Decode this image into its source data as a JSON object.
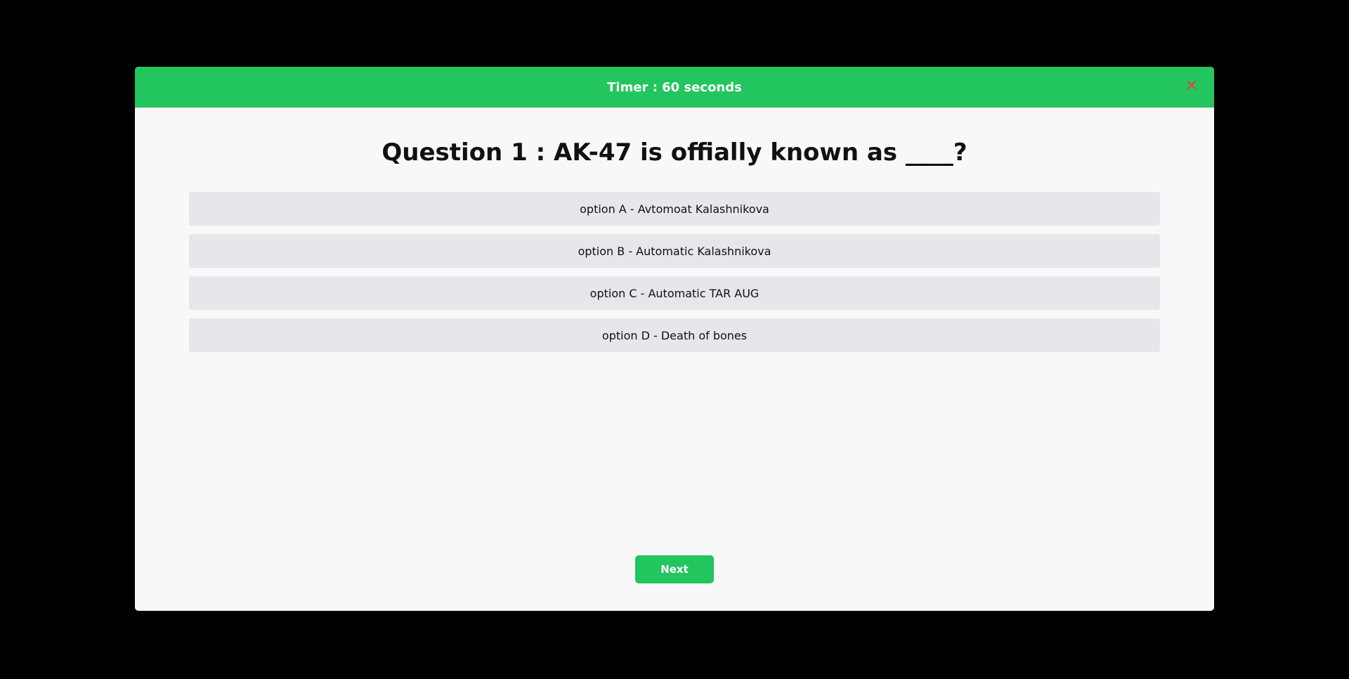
{
  "header": {
    "timer_text": "Timer : 60 seconds",
    "close_icon": "close-icon",
    "close_symbol": "✕"
  },
  "question": {
    "text": "Question 1 : AK-47 is offially known as ____?"
  },
  "options": [
    {
      "label": "option A - Avtomoat Kalashnikova"
    },
    {
      "label": "option B - Automatic Kalashnikova"
    },
    {
      "label": "option C - Automatic TAR AUG"
    },
    {
      "label": "option D - Death of bones"
    }
  ],
  "footer": {
    "next_label": "Next"
  },
  "colors": {
    "accent": "#22c55e",
    "option_bg": "#e5e7eb",
    "close": "#dc4a3a"
  }
}
